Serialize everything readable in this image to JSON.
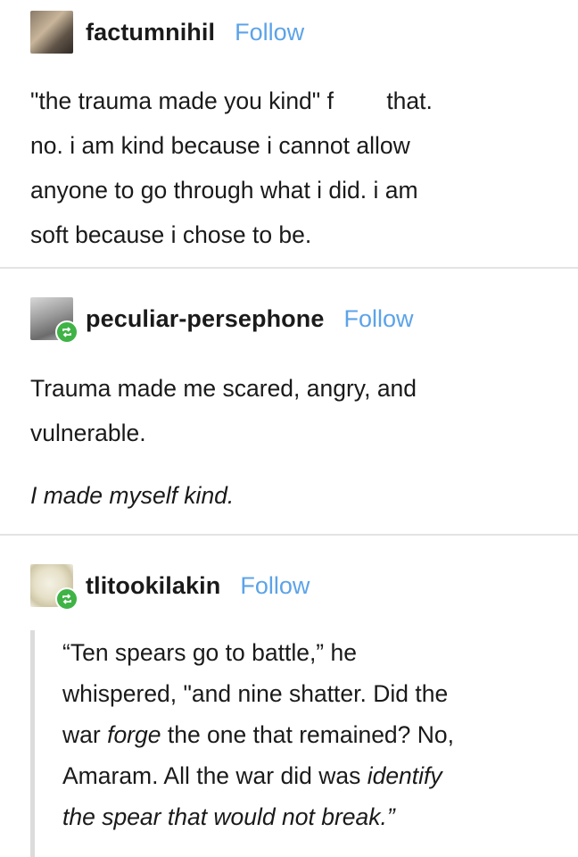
{
  "posts": [
    {
      "username": "factumnihil",
      "follow": "Follow",
      "lines": [
        "\"the trauma made you kind\" f",
        "that.",
        "no. i am kind because i cannot allow",
        "anyone to go through what i did. i am",
        "soft because i chose to be."
      ]
    },
    {
      "username": "peculiar-persephone",
      "follow": "Follow",
      "lines": [
        "Trauma made me scared, angry, and",
        "vulnerable.",
        "I made myself kind."
      ]
    },
    {
      "username": "tlitookilakin",
      "follow": "Follow",
      "quote": {
        "l1": "“Ten spears go to battle,” he",
        "l2": "whispered, \"and nine shatter. Did the",
        "l3a": "war ",
        "l3b": "forge",
        "l3c": " the one that remained? No,",
        "l4a": "Amaram. All the war did was ",
        "l4b": "identify",
        "l5": "the spear that would not break.”"
      }
    }
  ],
  "colors": {
    "follow": "#5ca3e8",
    "reblog": "#3fb345",
    "divider": "#e3e3e3"
  },
  "icons": [
    "avatar-image",
    "reblog-icon"
  ]
}
